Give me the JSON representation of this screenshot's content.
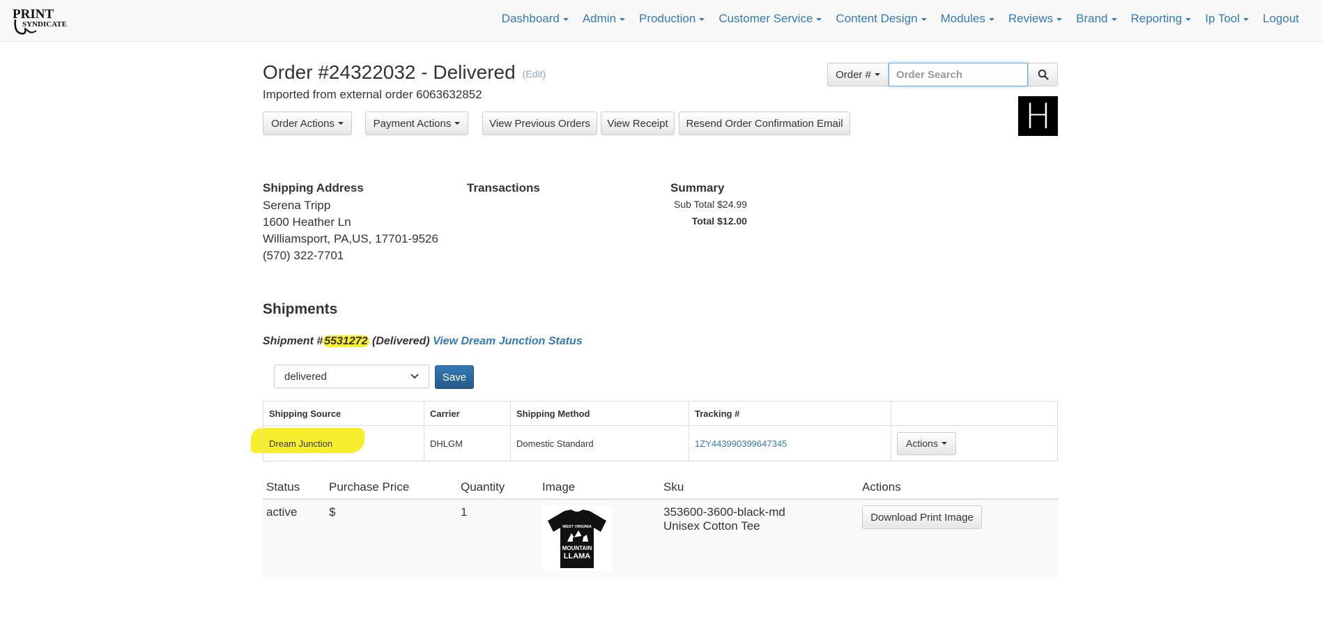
{
  "nav": {
    "items": [
      {
        "label": "Dashboard",
        "has_caret": true
      },
      {
        "label": "Admin",
        "has_caret": true
      },
      {
        "label": "Production",
        "has_caret": true
      },
      {
        "label": "Customer Service",
        "has_caret": true
      },
      {
        "label": "Content Design",
        "has_caret": true
      },
      {
        "label": "Modules",
        "has_caret": true
      },
      {
        "label": "Reviews",
        "has_caret": true
      },
      {
        "label": "Brand",
        "has_caret": true
      },
      {
        "label": "Reporting",
        "has_caret": true
      },
      {
        "label": "Ip Tool",
        "has_caret": true
      },
      {
        "label": "Logout",
        "has_caret": false
      }
    ],
    "logo_text": [
      "PRINT",
      "SYNDICATE"
    ]
  },
  "header": {
    "title": "Order #24322032 - Delivered",
    "edit_label": "(Edit)",
    "imported": "Imported from external order 6063632852",
    "brand_letter": "H"
  },
  "actions": {
    "order_actions": "Order Actions",
    "payment_actions": "Payment Actions",
    "view_previous_orders": "View Previous Orders",
    "view_receipt": "View Receipt",
    "resend_confirmation": "Resend Order Confirmation Email"
  },
  "search": {
    "dropdown_label": "Order #",
    "placeholder": "Order Search"
  },
  "shipping_address": {
    "heading": "Shipping Address",
    "name": "Serena Tripp",
    "street": "1600 Heather Ln",
    "city_line": "Williamsport, PA,US, 17701-9526",
    "phone": "(570) 322-7701"
  },
  "transactions": {
    "heading": "Transactions"
  },
  "summary": {
    "heading": "Summary",
    "subtotal_label": "Sub Total",
    "subtotal_value": "$24.99",
    "total_label": "Total",
    "total_value": "$12.00"
  },
  "shipments": {
    "heading": "Shipments",
    "shipment_prefix": "Shipment #",
    "shipment_number": "5531272",
    "shipment_status": "(Delivered)",
    "status_link": "View Dream Junction Status",
    "status_select_value": "delivered",
    "save_label": "Save",
    "table": {
      "headers": [
        "Shipping Source",
        "Carrier",
        "Shipping Method",
        "Tracking #",
        ""
      ],
      "row": {
        "source": "Dream Junction",
        "carrier": "DHLGM",
        "method": "Domestic Standard",
        "tracking": "1ZY443990399647345",
        "actions_label": "Actions"
      }
    }
  },
  "items": {
    "headers": [
      "Status",
      "Purchase Price",
      "Quantity",
      "Image",
      "Sku",
      "Actions"
    ],
    "rows": [
      {
        "status": "active",
        "price": "$",
        "quantity": "1",
        "sku": "353600-3600-black-md",
        "product": "Unisex Cotton Tee",
        "download_label": "Download Print Image",
        "shirt_text": [
          "WEST VIRGINIA",
          "MOUNTAIN",
          "LLAMA"
        ]
      }
    ]
  },
  "colors": {
    "link": "#337ab7",
    "highlight": "#f7ef2e",
    "primary_button": "#337ab7"
  }
}
